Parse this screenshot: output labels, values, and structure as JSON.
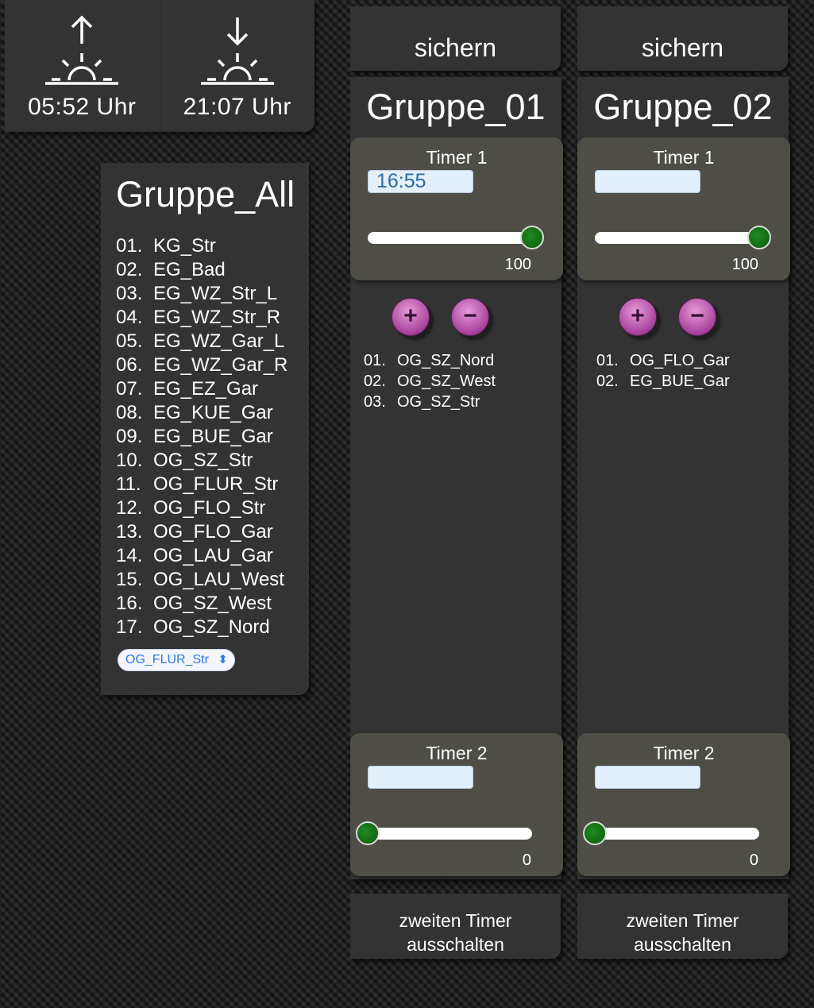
{
  "sun": {
    "sunrise_time": "05:52 Uhr",
    "sunset_time": "21:07 Uhr",
    "sunrise_icon": "sunrise-icon",
    "sunset_icon": "sunset-icon"
  },
  "group_all": {
    "title": "Gruppe_All",
    "items": [
      {
        "num": "01.",
        "name": "KG_Str"
      },
      {
        "num": "02.",
        "name": "EG_Bad"
      },
      {
        "num": "03.",
        "name": "EG_WZ_Str_L"
      },
      {
        "num": "04.",
        "name": "EG_WZ_Str_R"
      },
      {
        "num": "05.",
        "name": "EG_WZ_Gar_L"
      },
      {
        "num": "06.",
        "name": "EG_WZ_Gar_R"
      },
      {
        "num": "07.",
        "name": "EG_EZ_Gar"
      },
      {
        "num": "08.",
        "name": "EG_KUE_Gar"
      },
      {
        "num": "09.",
        "name": "EG_BUE_Gar"
      },
      {
        "num": "10.",
        "name": "OG_SZ_Str"
      },
      {
        "num": "11.",
        "name": "OG_FLUR_Str"
      },
      {
        "num": "12.",
        "name": "OG_FLO_Str"
      },
      {
        "num": "13.",
        "name": "OG_FLO_Gar"
      },
      {
        "num": "14.",
        "name": "OG_LAU_Gar"
      },
      {
        "num": "15.",
        "name": "OG_LAU_West"
      },
      {
        "num": "16.",
        "name": "OG_SZ_West"
      },
      {
        "num": "17.",
        "name": "OG_SZ_Nord"
      }
    ],
    "select_value": "OG_FLUR_Str"
  },
  "groups": [
    {
      "save_label": "sichern",
      "title": "Gruppe_01",
      "timer1": {
        "label": "Timer 1",
        "time": "16:55",
        "slider_value": "100",
        "slider_fraction": 1
      },
      "plus_symbol": "+",
      "minus_symbol": "−",
      "members": [
        {
          "num": "01.",
          "name": "OG_SZ_Nord"
        },
        {
          "num": "02.",
          "name": "OG_SZ_West"
        },
        {
          "num": "03.",
          "name": "OG_SZ_Str"
        }
      ],
      "timer2": {
        "label": "Timer 2",
        "time": "",
        "slider_value": "0",
        "slider_fraction": 0
      },
      "off_label_line1": "zweiten Timer",
      "off_label_line2": "ausschalten"
    },
    {
      "save_label": "sichern",
      "title": "Gruppe_02",
      "timer1": {
        "label": "Timer 1",
        "time": "",
        "slider_value": "100",
        "slider_fraction": 1
      },
      "plus_symbol": "+",
      "minus_symbol": "−",
      "members": [
        {
          "num": "01.",
          "name": "OG_FLO_Gar"
        },
        {
          "num": "02.",
          "name": "EG_BUE_Gar"
        }
      ],
      "timer2": {
        "label": "Timer 2",
        "time": "",
        "slider_value": "0",
        "slider_fraction": 0
      },
      "off_label_line1": "zweiten Timer",
      "off_label_line2": "ausschalten"
    }
  ],
  "colors": {
    "panel": "#333334",
    "timer_panel": "#4e4d46",
    "knob": "#147314",
    "round_button": "#c264b4",
    "input_bg": "#e3effa",
    "input_text": "#2e6aa3",
    "select_text": "#2a7ae2"
  }
}
